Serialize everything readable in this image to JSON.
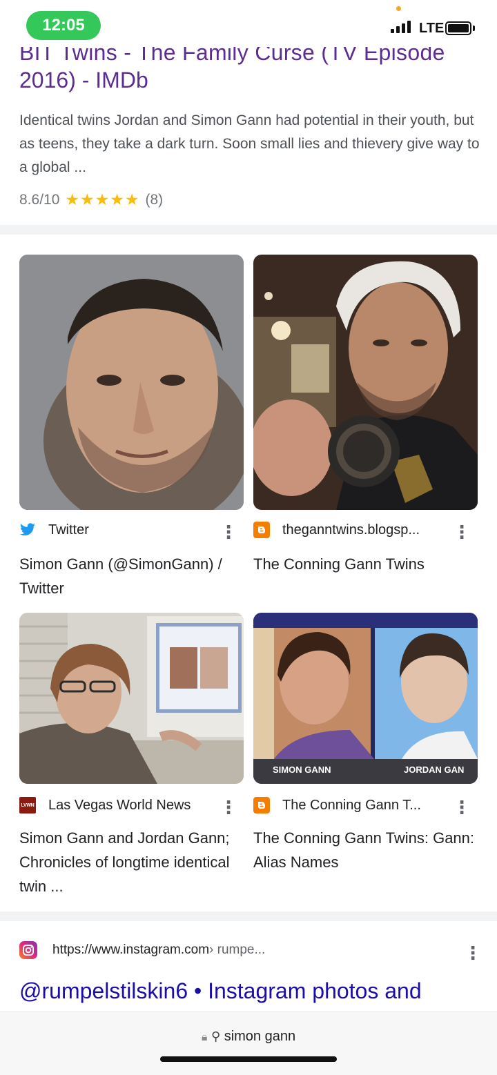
{
  "status_bar": {
    "time": "12:05",
    "network": "LTE"
  },
  "imdb_result": {
    "cut_title": "BIT Twins - The Family Curse (TV Episode",
    "title": "2016) - IMDb",
    "snippet": "Identical twins Jordan and Simon Gann had potential in their youth, but as teens, they take a dark turn. Soon small lies and thievery give way to a global ...",
    "rating": "8.6/10",
    "stars": "★★★★★",
    "stars_value": 4.3,
    "count": "(8)"
  },
  "images": [
    {
      "source": "Twitter",
      "title": "Simon Gann (@SimonGann) / Twitter",
      "icon": "twitter-bird-icon"
    },
    {
      "source": "theganntwins.blogsp...",
      "title": "The Conning Gann Twins",
      "icon": "blogger-icon"
    },
    {
      "source": "Las Vegas World News",
      "title": "Simon Gann and Jordan Gann; Chronicles of longtime identical twin ...",
      "icon": "lvwn-icon"
    },
    {
      "source": "The Conning Gann T...",
      "title": "The Conning Gann Twins: Gann: Alias Names",
      "icon": "blogger-icon",
      "caption_left": "SIMON GANN",
      "caption_right": "JORDAN GAN"
    }
  ],
  "instagram_result": {
    "url": "https://www.instagram.com",
    "path": " › rumpe...",
    "title": "@rumpelstilskin6 • Instagram photos and"
  },
  "address_bar": {
    "query": "simon gann"
  },
  "colors": {
    "visited_link": "#5c2d91",
    "link": "#1a0dab",
    "star": "#fbbc04",
    "time_pill": "#34c759"
  }
}
